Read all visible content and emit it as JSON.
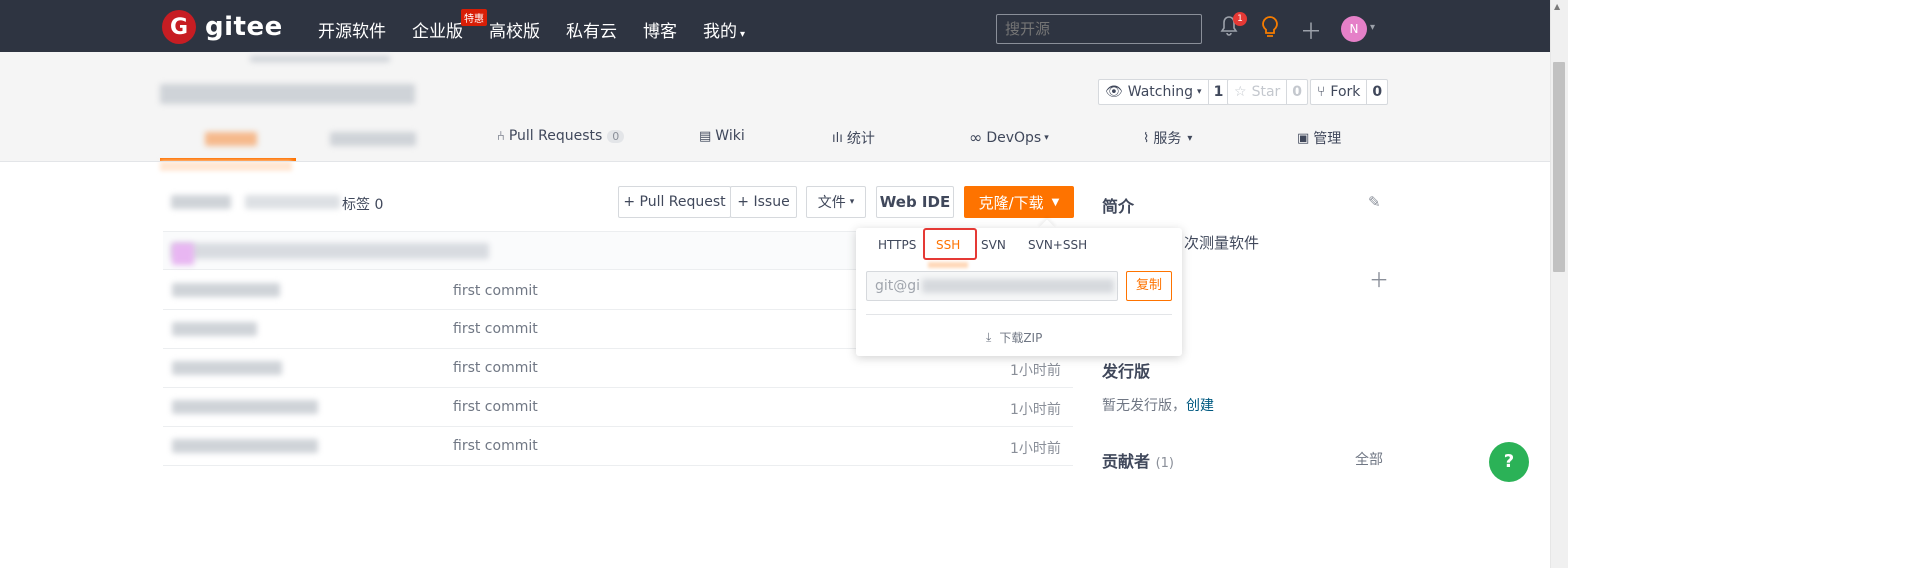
{
  "topbar": {
    "logo_mark": "G",
    "logo_text": "gitee",
    "nav": [
      {
        "label": "开源软件"
      },
      {
        "label": "企业版",
        "badge": "特惠"
      },
      {
        "label": "高校版"
      },
      {
        "label": "私有云"
      },
      {
        "label": "博客"
      },
      {
        "label": "我的",
        "caret": "▾"
      }
    ],
    "search_placeholder": "搜开源",
    "notification_count": "1",
    "avatar_letter": "N",
    "avatar_color": "#e580c8"
  },
  "repo_actions": {
    "watch_label": "Watching",
    "watch_count": "1",
    "star_label": "Star",
    "star_count": "0",
    "fork_label": "Fork",
    "fork_count": "0"
  },
  "tabs": {
    "pull_requests_label": "Pull Requests",
    "pull_requests_count": "0",
    "wiki_label": "Wiki",
    "stats_label": "统计",
    "devops_label": "DevOps",
    "services_label": "服务",
    "manage_label": "管理"
  },
  "toolbar": {
    "tags_suffix": "标签 0",
    "new_pr_label": "+ Pull Request",
    "new_issue_label": "+ Issue",
    "file_label": "文件",
    "web_ide_label": "Web IDE",
    "clone_label": "克隆/下载",
    "accent_color": "#fe7300"
  },
  "clone_dropdown": {
    "tabs": [
      "HTTPS",
      "SSH",
      "SVN",
      "SVN+SSH"
    ],
    "active_tab": "SSH",
    "url_value": "git@gi",
    "copy_label": "复制",
    "download_zip_label": "下载ZIP"
  },
  "files": [
    {
      "commit": "first commit",
      "time": ""
    },
    {
      "commit": "first commit",
      "time": ""
    },
    {
      "commit": "first commit",
      "time": "1小时前"
    },
    {
      "commit": "first commit",
      "time": "1小时前"
    },
    {
      "commit": "first commit",
      "time": "1小时前"
    }
  ],
  "sidebar": {
    "intro_title": "简介",
    "intro_text": "次测量软件",
    "releases_title": "发行版",
    "releases_text": "暂无发行版，",
    "releases_create": "创建",
    "contributors_title": "贡献者",
    "contributors_count": "(1)",
    "contributors_all": "全部"
  },
  "help_label": "?"
}
